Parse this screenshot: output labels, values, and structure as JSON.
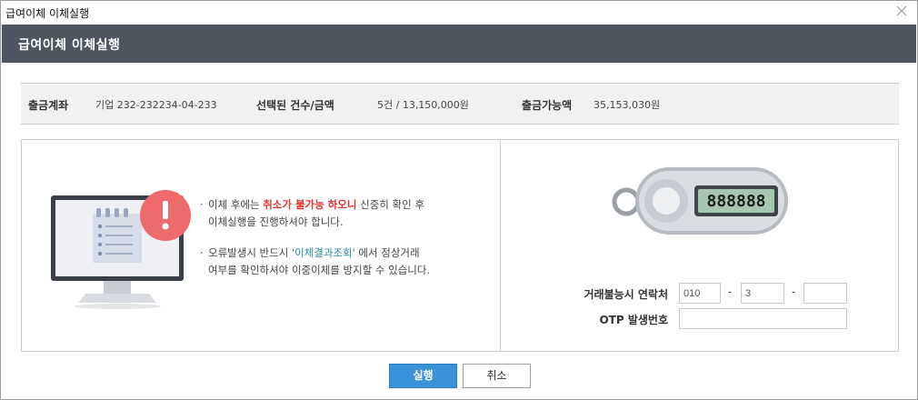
{
  "window": {
    "title": "급여이체 이체실행"
  },
  "header": {
    "title": "급여이체 이체실행"
  },
  "summary": {
    "account_label": "출금계좌",
    "account_value": "기업 232-232234-04-233",
    "selected_label": "선택된 건수/금액",
    "selected_value": "5건 / 13,150,000원",
    "available_label": "출금가능액",
    "available_value": "35,153,030원"
  },
  "notes": {
    "bullet": "·",
    "note1_pre": "이체 후에는 ",
    "note1_highlight": "취소가 불가능 하오니",
    "note1_post": " 신중히 확인 후",
    "note1_line2": "이체실행을 진행하셔야 합니다.",
    "note2_pre": "오류발생시 반드시 ",
    "note2_highlight": "'이체결과조회'",
    "note2_post": " 에서 정상거래",
    "note2_line2": "여부를 확인하셔야 이중이체를 방지할 수 있습니다."
  },
  "otp_device": {
    "display": "888888"
  },
  "form": {
    "contact_label": "거래불능시 연락처",
    "phone1": "010",
    "phone2": "3",
    "dash": "-",
    "otp_label": "OTP 발생번호",
    "otp_value": ""
  },
  "buttons": {
    "execute": "실행",
    "cancel": "취소"
  },
  "colors": {
    "header_bg": "#4e5662",
    "primary": "#3b92d8",
    "alert": "#ee6b6b",
    "highlight_red": "#e2342f",
    "highlight_teal": "#2a8ea6"
  }
}
